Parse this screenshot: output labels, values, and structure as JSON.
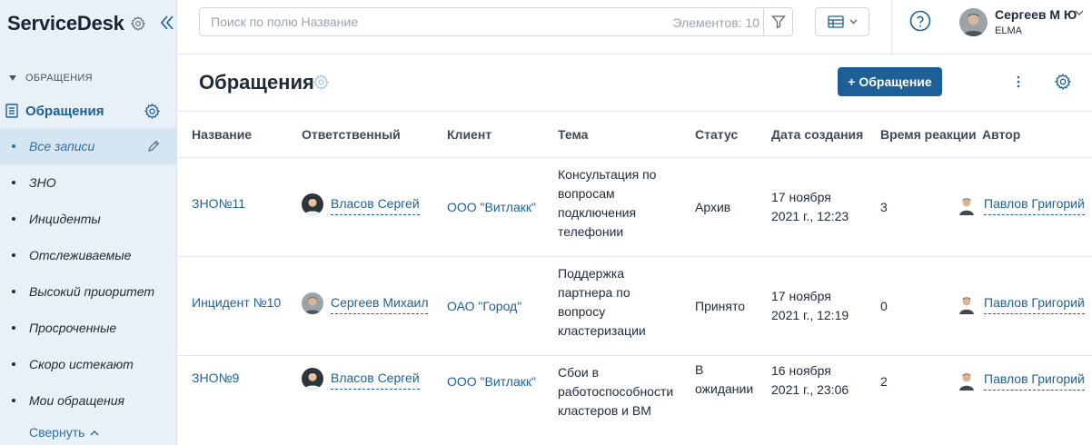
{
  "brand": {
    "title": "ServiceDesk"
  },
  "sidebar": {
    "section_label": "ОБРАЩЕНИЯ",
    "main_item": "Обращения",
    "items": [
      {
        "label": "Все записи",
        "active": true
      },
      {
        "label": "ЗНО"
      },
      {
        "label": "Инциденты"
      },
      {
        "label": "Отслеживаемые"
      },
      {
        "label": "Высокий приоритет"
      },
      {
        "label": "Просроченные"
      },
      {
        "label": "Скоро истекают"
      },
      {
        "label": "Мои обращения"
      }
    ],
    "collapse_label": "Свернуть"
  },
  "search": {
    "placeholder": "Поиск по полю Название",
    "count_label": "Элементов: 10"
  },
  "user": {
    "name": "Сергеев М Ю",
    "org": "ELMA"
  },
  "page": {
    "title": "Обращения",
    "add_button": "+ Обращение"
  },
  "table": {
    "columns": [
      "Название",
      "Ответственный",
      "Клиент",
      "Тема",
      "Статус",
      "Дата создания",
      "Время реакции",
      "Автор"
    ],
    "rows": [
      {
        "name": "ЗНО№11",
        "assignee": "Власов Сергей",
        "client": "ООО \"Витлакк\"",
        "topic": [
          "Консультация по",
          "вопросам",
          "подключения",
          "телефонии"
        ],
        "status": [
          "Архив"
        ],
        "date": [
          "17 ноября",
          "2021 г., 12:23"
        ],
        "reaction": "3",
        "author": "Павлов Григорий"
      },
      {
        "name": "Инцидент №10",
        "assignee": "Сергеев Михаил",
        "client": "ОАО \"Город\"",
        "topic": [
          "Поддержка",
          "партнера по",
          "вопросу",
          "кластеризации"
        ],
        "status": [
          "Принято"
        ],
        "date": [
          "17 ноября",
          "2021 г., 12:19"
        ],
        "reaction": "0",
        "author": "Павлов Григорий"
      },
      {
        "name": "ЗНО№9",
        "assignee": "Власов Сергей",
        "client": "ООО \"Витлакк\"",
        "topic": [
          "Сбои в",
          "работоспособности",
          "кластеров и ВМ"
        ],
        "status": [
          "В",
          "ожидании"
        ],
        "date": [
          "16 ноября",
          "2021 г., 23:06"
        ],
        "reaction": "2",
        "author": "Павлов Григорий"
      }
    ]
  },
  "colors": {
    "accent": "#1d5f97",
    "sidebar_bg": "#e9f1f8",
    "active_bg": "#d6e5f2"
  },
  "icons": [
    "gear-icon",
    "double-chevron-left-icon",
    "document-icon",
    "pencil-icon",
    "filter-icon",
    "table-view-icon",
    "help-icon",
    "kebab-icon",
    "chevron-up-icon",
    "chevron-down-icon"
  ]
}
